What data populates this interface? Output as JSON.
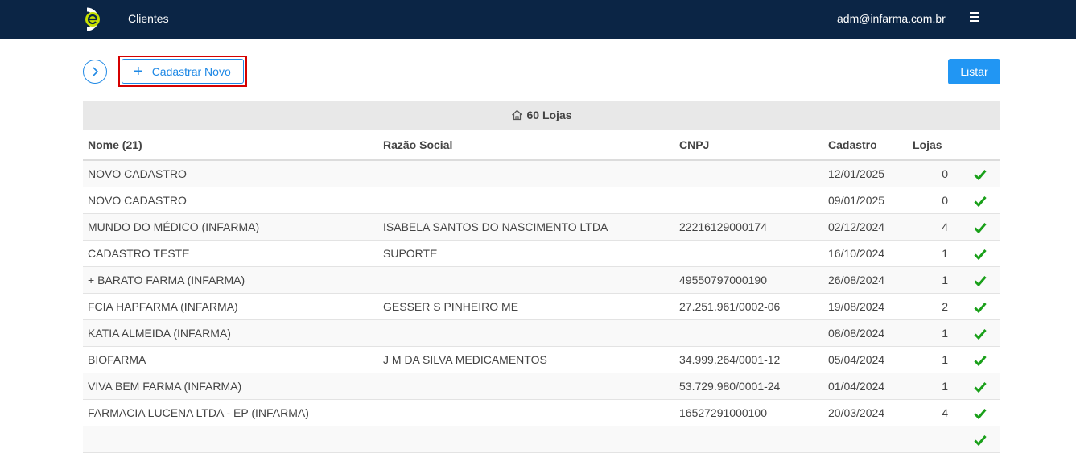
{
  "header": {
    "logo": "infarma-e-logo",
    "nav_clientes": "Clientes",
    "user_email": "adm@infarma.com.br",
    "menu_icon": "hamburger-icon"
  },
  "toolbar": {
    "toggle_icon": "chevron-right-icon",
    "new_button_label": "Cadastrar Novo",
    "list_button_label": "Listar"
  },
  "summary": {
    "stores_label": "60 Lojas",
    "icon": "home-icon"
  },
  "table": {
    "headers": [
      "Nome (21)",
      "Razão Social",
      "CNPJ",
      "Cadastro",
      "Lojas",
      ""
    ],
    "rows": [
      {
        "nome": "NOVO CADASTRO",
        "razao": "",
        "cnpj": "",
        "cadastro": "12/01/2025",
        "lojas": "0"
      },
      {
        "nome": "NOVO CADASTRO",
        "razao": "",
        "cnpj": "",
        "cadastro": "09/01/2025",
        "lojas": "0"
      },
      {
        "nome": "MUNDO DO MÉDICO (INFARMA)",
        "razao": "ISABELA SANTOS DO NASCIMENTO LTDA",
        "cnpj": "22216129000174",
        "cadastro": "02/12/2024",
        "lojas": "4"
      },
      {
        "nome": "CADASTRO TESTE",
        "razao": "SUPORTE",
        "cnpj": "",
        "cadastro": "16/10/2024",
        "lojas": "1"
      },
      {
        "nome": "+ BARATO FARMA (INFARMA)",
        "razao": "",
        "cnpj": "49550797000190",
        "cadastro": "26/08/2024",
        "lojas": "1"
      },
      {
        "nome": "FCIA HAPFARMA (INFARMA)",
        "razao": "GESSER S PINHEIRO ME",
        "cnpj": "27.251.961/0002-06",
        "cadastro": "19/08/2024",
        "lojas": "2"
      },
      {
        "nome": "KATIA ALMEIDA (INFARMA)",
        "razao": "",
        "cnpj": "",
        "cadastro": "08/08/2024",
        "lojas": "1"
      },
      {
        "nome": "BIOFARMA",
        "razao": "J M DA SILVA MEDICAMENTOS",
        "cnpj": "34.999.264/0001-12",
        "cadastro": "05/04/2024",
        "lojas": "1"
      },
      {
        "nome": "VIVA BEM FARMA (INFARMA)",
        "razao": "",
        "cnpj": "53.729.980/0001-24",
        "cadastro": "01/04/2024",
        "lojas": "1"
      },
      {
        "nome": "FARMACIA LUCENA LTDA - EP (INFARMA)",
        "razao": "",
        "cnpj": "16527291000100",
        "cadastro": "20/03/2024",
        "lojas": "4"
      },
      {
        "nome": "",
        "razao": "",
        "cnpj": "",
        "cadastro": "",
        "lojas": ""
      }
    ],
    "status_icon": "check-icon"
  },
  "colors": {
    "topbar": "#0b2545",
    "accent": "#2196f3",
    "highlight_border": "#d50000",
    "check": "#1aa01a",
    "logo": "#c6e000"
  }
}
